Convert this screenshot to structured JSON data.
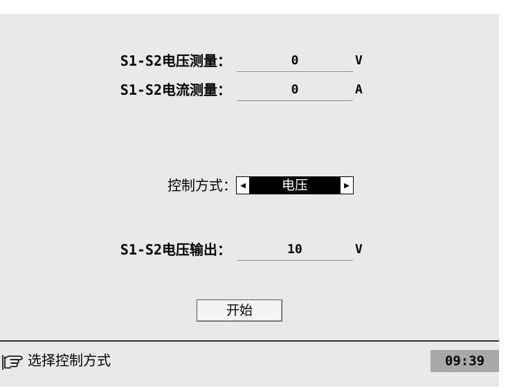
{
  "measurements": {
    "voltage": {
      "label": "S1-S2电压测量：",
      "value": "0",
      "unit": "V"
    },
    "current": {
      "label": "S1-S2电流测量：",
      "value": "0",
      "unit": "A"
    }
  },
  "control": {
    "label": "控制方式：",
    "value": "电压",
    "left_arrow": "◀",
    "right_arrow": "▶"
  },
  "output": {
    "label": "S1-S2电压输出：",
    "value": "10",
    "unit": "V"
  },
  "start_button": "开始",
  "status": {
    "icon": "pointing-hand-icon",
    "hint": "选择控制方式",
    "time": "09:39"
  }
}
